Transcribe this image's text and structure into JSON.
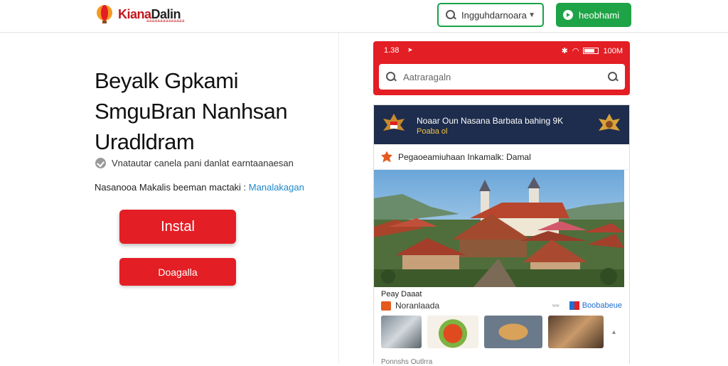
{
  "header": {
    "logo_text_red": "Kiana",
    "logo_text_dark": "Dalin",
    "logo_sub": "aaaaaaaaaaaaaa",
    "language_select": "Ingguhdarnoara",
    "action_button": "heobhami"
  },
  "hero": {
    "title_lines": [
      "Beyalk Gpkami",
      "SmguBran Nanhsan",
      "Uradldram"
    ],
    "check_text": "Vnatautar canela pani danlat earntaanaesan",
    "note_text": "Nasanooa Makalis beeman mactaki :",
    "note_link": "Manalakagan",
    "install_button": "Instal",
    "secondary_button": "Doagalla"
  },
  "phone": {
    "status_time": "1.38",
    "status_right": "100M",
    "search_placeholder": "Aatraragaln",
    "card_title": "Noaar Oun Nasana Barbata bahing 9K",
    "card_subtitle": "Poaba ol",
    "section_label": "Pegaoeamiuhaan Inkamalk: Damal",
    "photo_caption": "Peay Daaat",
    "news_label": "Noranlaada",
    "news_tag": "Boobabeue",
    "bottom_caption": "Ponnshs Outlrra"
  },
  "colors": {
    "brand_red": "#e31e24",
    "green": "#1ea446",
    "navy": "#1e2d4d",
    "link_blue": "#1e88c9"
  },
  "icons": [
    "balloon-logo-icon",
    "search-icon",
    "chevron-down-icon",
    "play-icon",
    "check-circle-icon",
    "wifi-icon",
    "battery-icon",
    "garuda-emblem-icon",
    "flower-icon",
    "flag-icon"
  ]
}
